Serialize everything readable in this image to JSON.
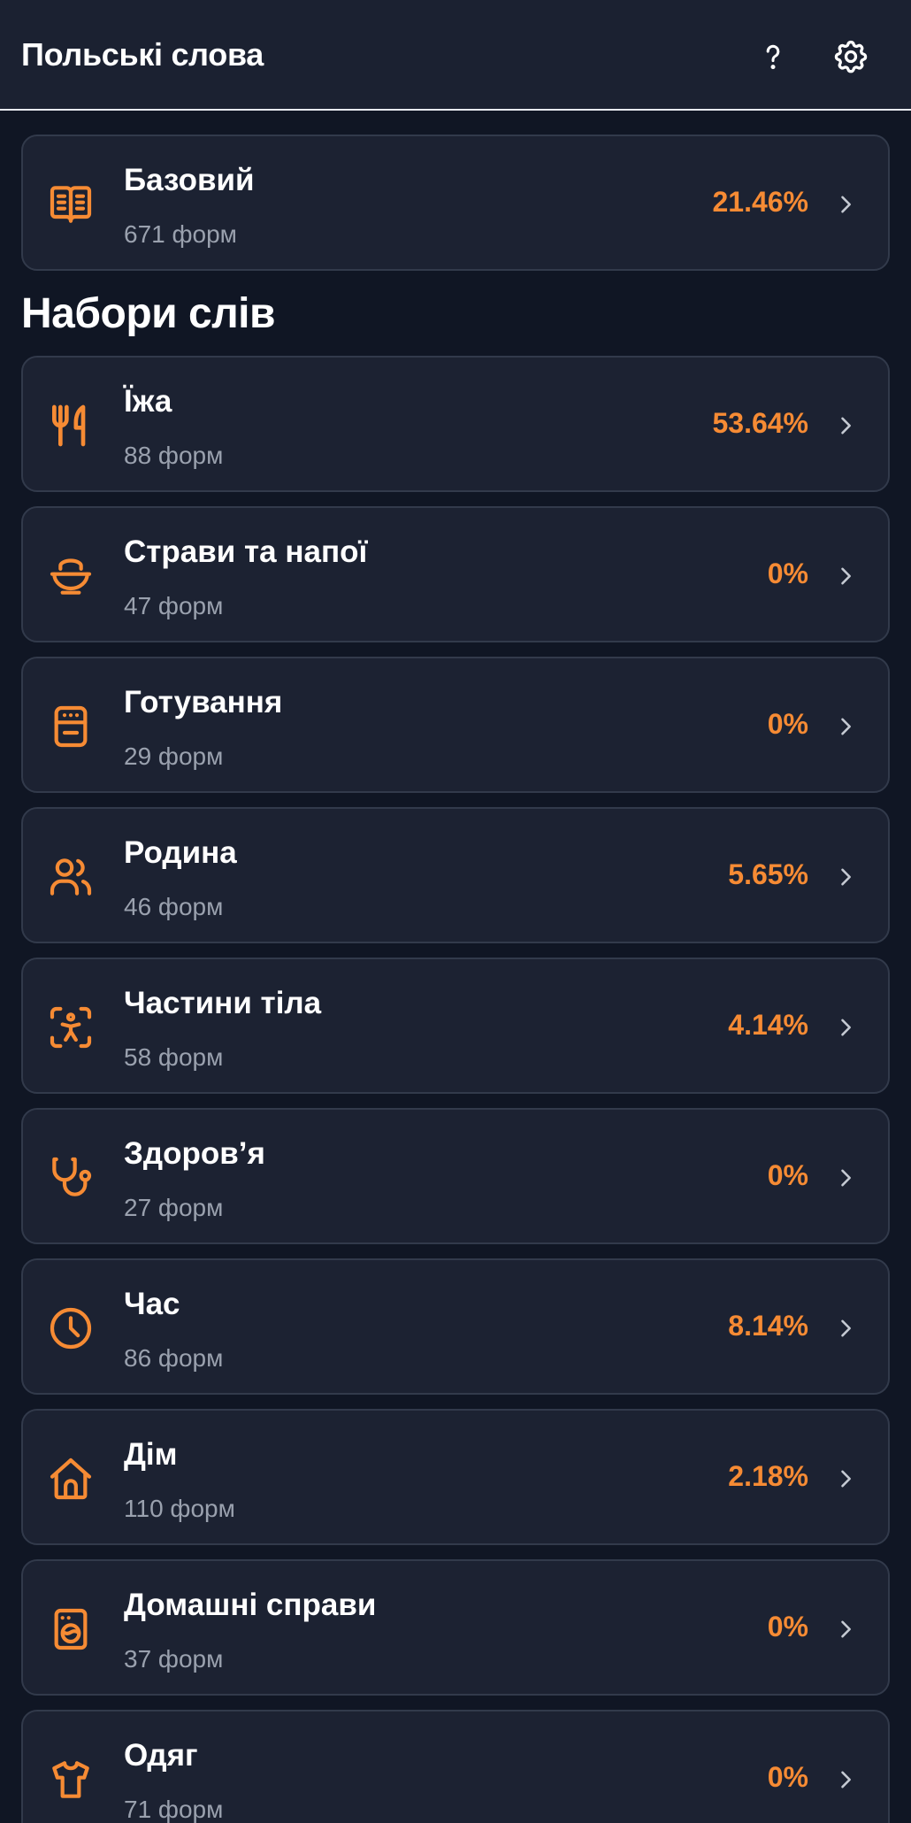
{
  "header": {
    "title": "Польські слова"
  },
  "base_set": {
    "title": "Базовий",
    "forms": "671 форм",
    "percent": "21.46%"
  },
  "section_title": "Набори слів",
  "sets": [
    {
      "icon": "utensils-icon",
      "title": "Їжа",
      "forms": "88 форм",
      "percent": "53.64%"
    },
    {
      "icon": "bowl-icon",
      "title": "Страви та напої",
      "forms": "47 форм",
      "percent": "0%"
    },
    {
      "icon": "oven-icon",
      "title": "Готування",
      "forms": "29 форм",
      "percent": "0%"
    },
    {
      "icon": "users-icon",
      "title": "Родина",
      "forms": "46 форм",
      "percent": "5.65%"
    },
    {
      "icon": "body-scan-icon",
      "title": "Частини тіла",
      "forms": "58 форм",
      "percent": "4.14%"
    },
    {
      "icon": "stethoscope-icon",
      "title": "Здоров’я",
      "forms": "27 форм",
      "percent": "0%"
    },
    {
      "icon": "clock-icon",
      "title": "Час",
      "forms": "86 форм",
      "percent": "8.14%"
    },
    {
      "icon": "house-icon",
      "title": "Дім",
      "forms": "110 форм",
      "percent": "2.18%"
    },
    {
      "icon": "washing-machine-icon",
      "title": "Домашні справи",
      "forms": "37 форм",
      "percent": "0%"
    },
    {
      "icon": "shirt-icon",
      "title": "Одяг",
      "forms": "71 форм",
      "percent": "0%"
    }
  ],
  "colors": {
    "accent": "#f68b34",
    "background": "#101624",
    "card": "#1c2232",
    "card_border": "#323a4b",
    "muted_text": "#9aa1ae"
  }
}
